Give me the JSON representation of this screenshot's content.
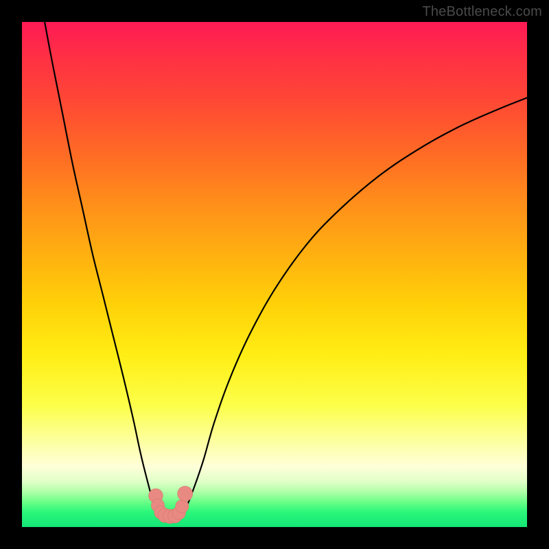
{
  "watermark": "TheBottleneck.com",
  "colors": {
    "frame": "#000000",
    "curve": "#000000",
    "marker_fill": "#e88a82",
    "marker_stroke": "#d8746c"
  },
  "chart_data": {
    "type": "line",
    "title": "",
    "xlabel": "",
    "ylabel": "",
    "xlim": [
      0,
      100
    ],
    "ylim": [
      0,
      100
    ],
    "grid": false,
    "series": [
      {
        "name": "left-branch",
        "x": [
          4.5,
          6,
          8,
          10,
          12,
          14,
          16,
          18,
          20,
          22,
          23.5,
          25,
          26,
          27,
          27.7
        ],
        "y": [
          100,
          92,
          82,
          72,
          63,
          54,
          46,
          38,
          30,
          21.5,
          14.5,
          8.5,
          5,
          3,
          2.2
        ]
      },
      {
        "name": "right-branch",
        "x": [
          31.3,
          32,
          33,
          34.5,
          36,
          38,
          41,
          45,
          50,
          56,
          62,
          70,
          78,
          86,
          94,
          100
        ],
        "y": [
          2.2,
          3,
          5,
          9,
          13.5,
          20.5,
          29,
          38,
          47,
          55.5,
          62,
          69,
          74.5,
          79,
          82.6,
          85
        ]
      }
    ],
    "markers": {
      "name": "valley-markers",
      "points": [
        {
          "x": 26.5,
          "y": 6.2,
          "r": 1.4
        },
        {
          "x": 26.9,
          "y": 4.3,
          "r": 1.3
        },
        {
          "x": 27.5,
          "y": 2.9,
          "r": 1.3
        },
        {
          "x": 28.3,
          "y": 2.3,
          "r": 1.4
        },
        {
          "x": 29.3,
          "y": 2.1,
          "r": 1.4
        },
        {
          "x": 30.3,
          "y": 2.2,
          "r": 1.4
        },
        {
          "x": 31.1,
          "y": 2.8,
          "r": 1.3
        },
        {
          "x": 31.7,
          "y": 4.1,
          "r": 1.3
        },
        {
          "x": 32.3,
          "y": 6.6,
          "r": 1.5
        }
      ]
    }
  }
}
